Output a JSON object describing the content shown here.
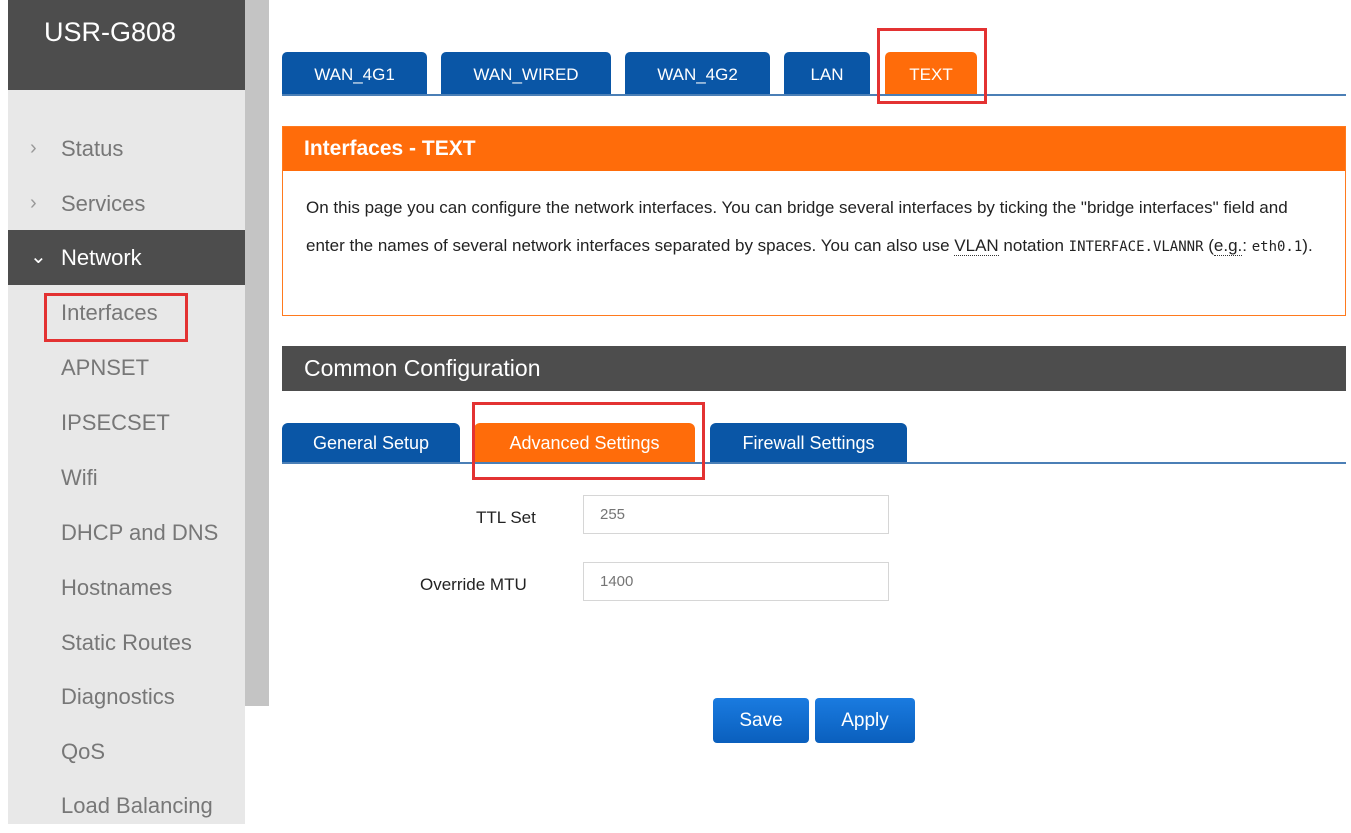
{
  "app": {
    "brand": "USR-G808"
  },
  "sidebar": {
    "menu": [
      {
        "label": "Status",
        "chevron": "›"
      },
      {
        "label": "Services",
        "chevron": "›"
      },
      {
        "label": "Network",
        "chevron": "⌄"
      }
    ],
    "network_items": [
      "Interfaces",
      "APNSET",
      "IPSECSET",
      "Wifi",
      "DHCP and DNS",
      "Hostnames",
      "Static Routes",
      "Diagnostics",
      "QoS",
      "Load Balancing"
    ]
  },
  "tabs": [
    "WAN_4G1",
    "WAN_WIRED",
    "WAN_4G2",
    "LAN",
    "TEXT"
  ],
  "interfaces": {
    "title": "Interfaces - TEXT",
    "desc_part1": "On this page you can configure the network interfaces. You can bridge several interfaces by ticking the \"bridge interfaces\" field and enter the names of several network interfaces separated by spaces. You can also use ",
    "vlan": "VLAN",
    "desc_part2": " notation ",
    "code1": "INTERFACE.VLANNR",
    "desc_part3": " (",
    "eg": "e.g.",
    "desc_part4": ": ",
    "code2": "eth0.1",
    "desc_part5": ")."
  },
  "common": {
    "title": "Common Configuration",
    "subtabs": [
      "General Setup",
      "Advanced Settings",
      "Firewall Settings"
    ]
  },
  "fields": {
    "ttl_label": "TTL Set",
    "ttl_placeholder": "255",
    "mtu_label": "Override MTU",
    "mtu_placeholder": "1400"
  },
  "buttons": {
    "save": "Save",
    "apply": "Apply"
  },
  "colors": {
    "accent": "#ff6c0a",
    "tab_blue": "#0a56a6",
    "highlight": "#e33232",
    "dark": "#4d4d4d"
  }
}
